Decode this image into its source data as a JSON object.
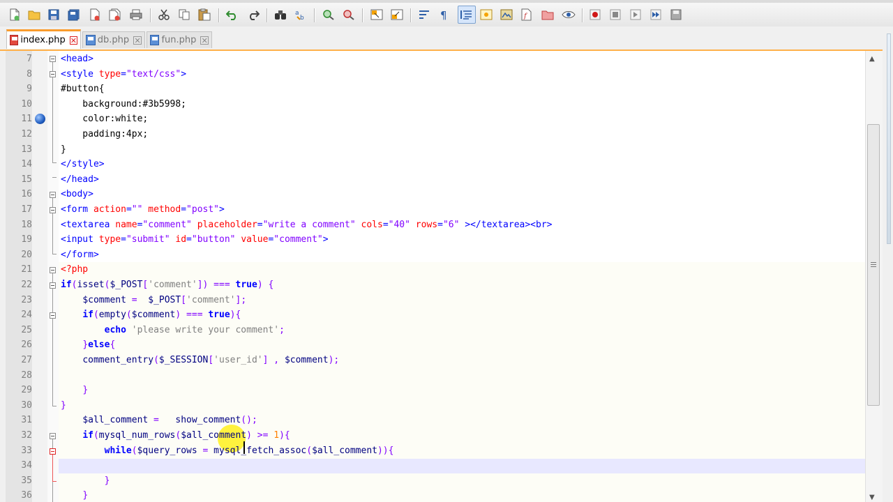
{
  "toolbar": {
    "buttons": [
      "new-file-icon",
      "open-file-icon",
      "save-icon",
      "save-all-icon",
      "close-icon",
      "close-all-icon",
      "print-icon",
      "cut-icon",
      "copy-icon",
      "paste-icon",
      "undo-icon",
      "redo-icon",
      "find-icon",
      "replace-icon",
      "zoom-in-icon",
      "zoom-out-icon",
      "sync-vertical-icon",
      "sync-horizontal-icon",
      "word-wrap-icon",
      "show-all-chars-icon",
      "indent-guide-icon",
      "user-language-icon",
      "doc-map-icon",
      "function-list-icon",
      "folder-workspace-icon",
      "monitoring-icon",
      "record-macro-icon",
      "stop-record-icon",
      "play-macro-icon",
      "run-macro-multiple-icon",
      "save-macro-icon"
    ]
  },
  "tabs": [
    {
      "label": "index.php",
      "active": true,
      "icon": "red"
    },
    {
      "label": "db.php",
      "active": false,
      "icon": "blue"
    },
    {
      "label": "fun.php",
      "active": false,
      "icon": "blue"
    }
  ],
  "editor": {
    "line_numbers": [
      "7",
      "8",
      "9",
      "10",
      "11",
      "12",
      "13",
      "14",
      "15",
      "16",
      "17",
      "18",
      "19",
      "20",
      "21",
      "22",
      "23",
      "24",
      "25",
      "26",
      "27",
      "28",
      "29",
      "30",
      "31",
      "32",
      "33",
      "34",
      "35",
      "36"
    ],
    "lines": [
      "<head>",
      "<style type=\"text/css\">",
      "#button{",
      "    background:#3b5998;",
      "    color:white;",
      "    padding:4px;",
      "}",
      "</style>",
      "</head>",
      "<body>",
      "<form action=\"\" method=\"post\">",
      "<textarea name=\"comment\" placeholder=\"write a comment\" cols=\"40\" rows=\"6\" ></textarea><br>",
      "<input type=\"submit\" id=\"button\" value=\"comment\">",
      "</form>",
      "<?php",
      "if(isset($_POST['comment']) === true) {",
      "    $comment =  $_POST['comment'];",
      "    if(empty($comment) === true){",
      "        echo 'please write your comment';",
      "    }else{",
      "    comment_entry($_SESSION['user_id'] , $comment);",
      "",
      "    }",
      "}",
      "    $all_comment =   show_comment();",
      "    if(mysql_num_rows($all_comment) >= 1){",
      "        while($query_rows = mysql_fetch_assoc($all_comment)){",
      "",
      "        }",
      "    }"
    ]
  },
  "colors": {
    "accent_tab": "#fa9c2d",
    "tag": "#0000ff",
    "attribute": "#ff0000",
    "string": "#8000ff",
    "php_keyword": "#0000ff",
    "variable": "#000080",
    "single_quoted": "#808080",
    "number": "#ff8000"
  }
}
